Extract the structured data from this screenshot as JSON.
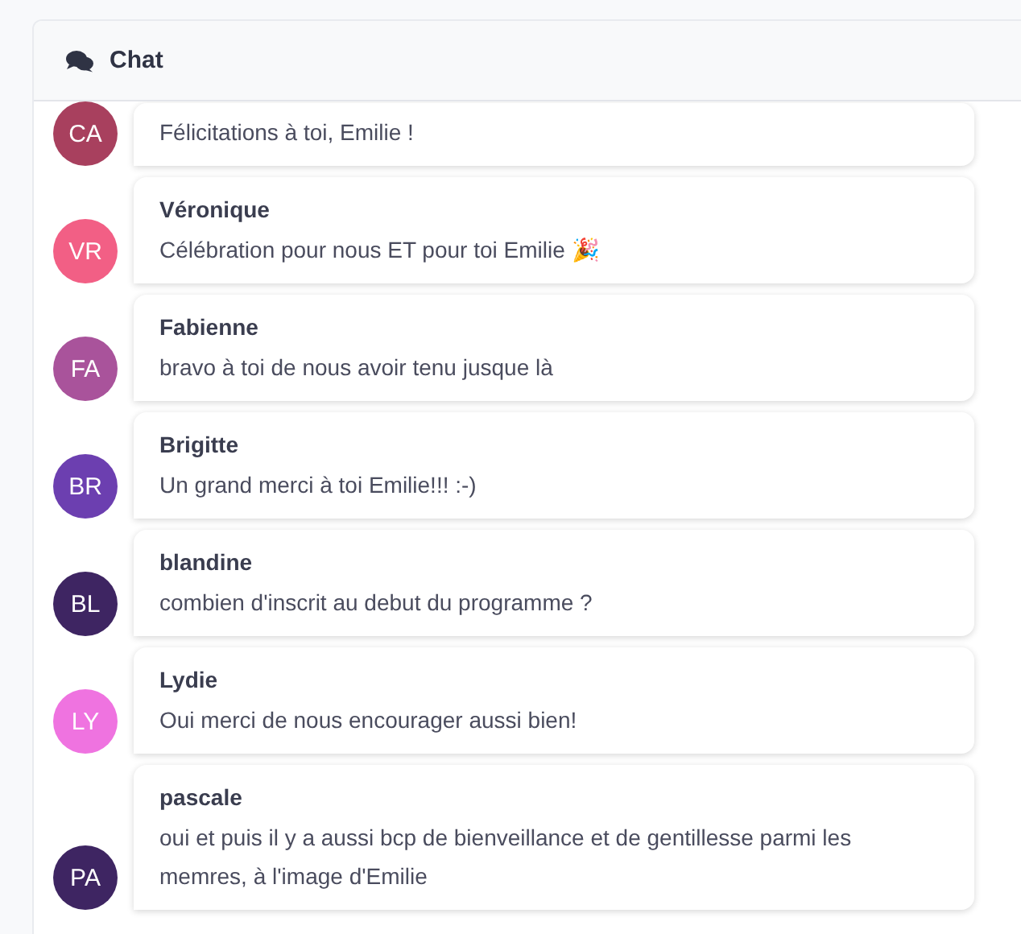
{
  "panel": {
    "title": "Chat"
  },
  "messages": [
    {
      "initials": "CA",
      "color": "#a8405e",
      "text": "Félicitations à toi, Emilie !"
    },
    {
      "initials": "VR",
      "color": "#f25f85",
      "name": "Véronique",
      "text": "Célébration pour nous ET pour toi Emilie 🎉"
    },
    {
      "initials": "FA",
      "color": "#a9539b",
      "name": "Fabienne",
      "text": "bravo à toi de nous avoir tenu jusque là"
    },
    {
      "initials": "BR",
      "color": "#6c3fb0",
      "name": "Brigitte",
      "text": "Un grand merci à toi Emilie!!! :-)"
    },
    {
      "initials": "BL",
      "color": "#3e2562",
      "name": "blandine",
      "text": "combien d'inscrit au debut du programme ?"
    },
    {
      "initials": "LY",
      "color": "#ef73e0",
      "name": "Lydie",
      "text": "Oui merci de nous encourager aussi bien!"
    },
    {
      "initials": "PA",
      "color": "#3e2562",
      "name": "pascale",
      "text": "oui et puis il y a aussi bcp de bienveillance et de gentillesse parmi les memres, à l'image d'Emilie"
    }
  ]
}
